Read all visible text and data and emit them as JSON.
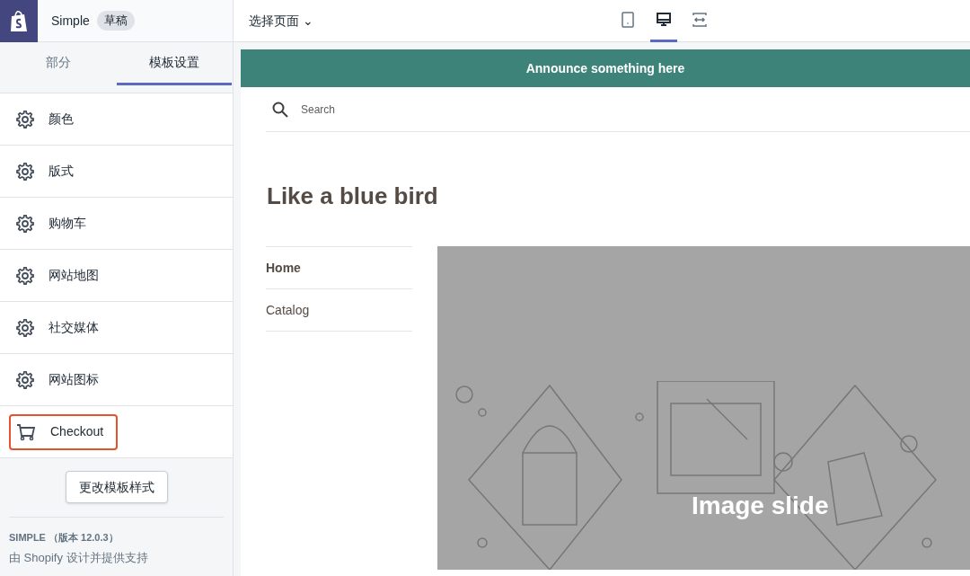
{
  "header": {
    "theme_name": "Simple",
    "badge": "草稿",
    "page_select": "选择页面 ⌄"
  },
  "device_buttons": [
    {
      "kind": "mobile",
      "selected": false
    },
    {
      "kind": "desktop",
      "selected": true
    },
    {
      "kind": "fullwidth",
      "selected": false
    }
  ],
  "tabs": [
    {
      "label": "部分",
      "selected": false
    },
    {
      "label": "模板设置",
      "selected": true
    }
  ],
  "settings": [
    {
      "kind": "gear",
      "label": "颜色",
      "highlighted": false
    },
    {
      "kind": "gear",
      "label": "版式",
      "highlighted": false
    },
    {
      "kind": "gear",
      "label": "购物车",
      "highlighted": false
    },
    {
      "kind": "gear",
      "label": "网站地图",
      "highlighted": false
    },
    {
      "kind": "gear",
      "label": "社交媒体",
      "highlighted": false
    },
    {
      "kind": "gear",
      "label": "网站图标",
      "highlighted": false
    },
    {
      "kind": "cart",
      "label": "Checkout",
      "highlighted": true
    }
  ],
  "change_theme_button": "更改模板样式",
  "footer": {
    "theme_version": "SIMPLE （版本 12.0.3）",
    "credit": "由 Shopify 设计并提供支持"
  },
  "preview": {
    "announcement": "Announce something here",
    "search_placeholder": "Search",
    "title": "Like a blue bird",
    "nav": [
      {
        "label": "Home",
        "selected": true
      },
      {
        "label": "Catalog",
        "selected": false
      }
    ],
    "slide_caption": "Image slide"
  }
}
